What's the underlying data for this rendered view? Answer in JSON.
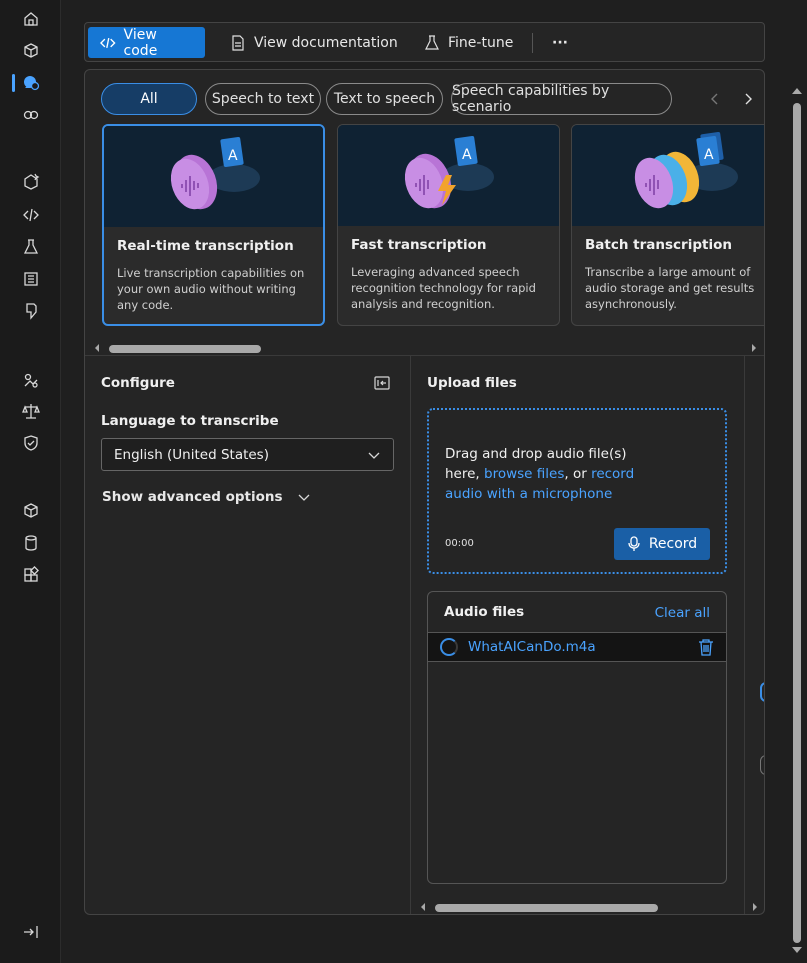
{
  "rail": {
    "icons": [
      "home-icon",
      "models-icon",
      "chat-icon",
      "compare-icon",
      "ai-services-icon",
      "code-icon",
      "flask-icon",
      "data-icon",
      "prompt-icon",
      "tune-icon",
      "scale-icon",
      "shield-icon",
      "box-icon",
      "database-icon",
      "apps-icon",
      "sign-out-icon"
    ]
  },
  "toolbar": {
    "view_code": "View code",
    "view_docs": "View documentation",
    "fine_tune": "Fine-tune",
    "more": "···"
  },
  "filters": {
    "all": "All",
    "speech_to_text": "Speech to text",
    "text_to_speech": "Text to speech",
    "by_scenario": "Speech capabilities by scenario"
  },
  "cards": [
    {
      "title": "Real-time transcription",
      "desc": "Live transcription capabilities on your own audio without writing any code."
    },
    {
      "title": "Fast transcription",
      "desc": "Leveraging advanced speech recognition technology for rapid analysis and recognition."
    },
    {
      "title": "Batch transcription",
      "desc": "Transcribe a large amount of audio storage and get results asynchronously."
    }
  ],
  "configure": {
    "title": "Configure",
    "language_label": "Language to transcribe",
    "language_value": "English (United States)",
    "advanced": "Show advanced options"
  },
  "upload": {
    "title": "Upload files",
    "drag_text_1": "Drag and drop audio file(s) here, ",
    "browse": "browse files",
    "drag_text_2": ", or ",
    "record_link": "record audio with a microphone",
    "timer": "00:00",
    "record_button": "Record"
  },
  "audio_files": {
    "title": "Audio files",
    "clear_all": "Clear all",
    "items": [
      "WhatAICanDo.m4a"
    ]
  },
  "colors": {
    "accent": "#1677d4",
    "link": "#4aa3ff",
    "background": "#1f1f1f",
    "panel": "#252525"
  }
}
